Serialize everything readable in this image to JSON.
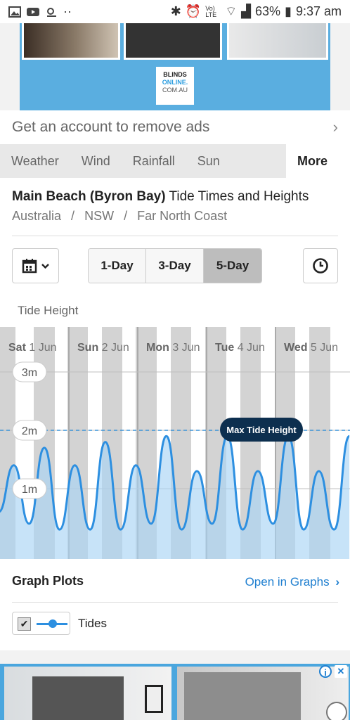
{
  "status_bar": {
    "battery": "63%",
    "time": "9:37 am",
    "volte": "Vo) LTE"
  },
  "ad_top": {
    "logo_line1": "BLINDS",
    "logo_line2": "ONLINE.",
    "logo_line3": "COM.AU"
  },
  "remove_ads": {
    "label": "Get an account to remove ads",
    "chevron": "›"
  },
  "tabs": {
    "items": [
      "Weather",
      "Wind",
      "Rainfall",
      "Sun"
    ],
    "more": "More"
  },
  "header": {
    "title_bold": "Main Beach (Byron Bay)",
    "title_rest": " Tide Times and Heights",
    "breadcrumb": [
      "Australia",
      "NSW",
      "Far North Coast"
    ],
    "separator": "/"
  },
  "controls": {
    "ranges": [
      "1-Day",
      "3-Day",
      "5-Day"
    ],
    "selected": "5-Day",
    "chart_heading": "Tide Height"
  },
  "chart_data": {
    "type": "area",
    "ylabel": "Tide Height",
    "y_unit": "m",
    "y_ticks": [
      "3m",
      "2m",
      "1m"
    ],
    "ylim": [
      0,
      3.5
    ],
    "days": [
      {
        "weekday": "Sat",
        "date": "1 Jun"
      },
      {
        "weekday": "Sun",
        "date": "2 Jun"
      },
      {
        "weekday": "Mon",
        "date": "3 Jun"
      },
      {
        "weekday": "Tue",
        "date": "4 Jun"
      },
      {
        "weekday": "Wed",
        "date": "5 Jun"
      }
    ],
    "max_label": "Max Tide Height",
    "max_value": 2.0,
    "series": [
      {
        "values": [
          0.6,
          1.4,
          0.4,
          1.7,
          0.3,
          1.4,
          0.3,
          1.8,
          0.3,
          1.4,
          0.4,
          1.9,
          0.3,
          1.3,
          0.4,
          1.9,
          0.3,
          1.3,
          0.4,
          1.9,
          0.3,
          1.3,
          0.3,
          1.9
        ]
      }
    ],
    "grid": true,
    "colors": {
      "line": "#2d8fe0",
      "fill": "#a9d4f5",
      "night": "#d3d3d3",
      "max_line": "#3a93d8",
      "max_badge": "#0d2f4f"
    }
  },
  "graph_plots": {
    "title": "Graph Plots",
    "link": "Open in Graphs",
    "link_chevron": "›",
    "legend_label": "Tides",
    "checked": "✔"
  },
  "ad_bottom": {
    "info": "i",
    "close": "✕"
  }
}
